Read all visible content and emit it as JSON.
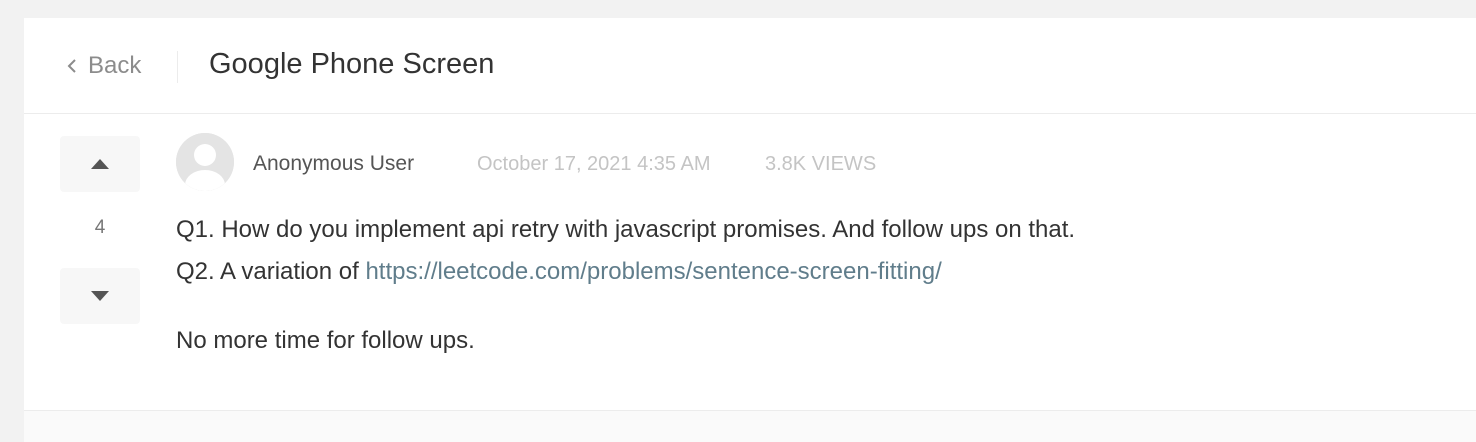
{
  "header": {
    "back_label": "Back",
    "title": "Google Phone Screen"
  },
  "vote": {
    "count": "4"
  },
  "post": {
    "author": "Anonymous User",
    "date": "October 17, 2021 4:35 AM",
    "views": "3.8K VIEWS",
    "q1": "Q1. How do you implement api retry with javascript promises. And follow ups on that.",
    "q2_prefix": "Q2. A variation of ",
    "q2_link": "https://leetcode.com/problems/sentence-screen-fitting/",
    "closing": "No more time for follow ups."
  },
  "icons": {
    "back": "chevron-left-icon",
    "upvote": "caret-up-icon",
    "downvote": "caret-down-icon",
    "avatar": "default-user-avatar"
  },
  "colors": {
    "link": "#607d8b",
    "muted": "#c4c4c4",
    "text": "#333333"
  }
}
